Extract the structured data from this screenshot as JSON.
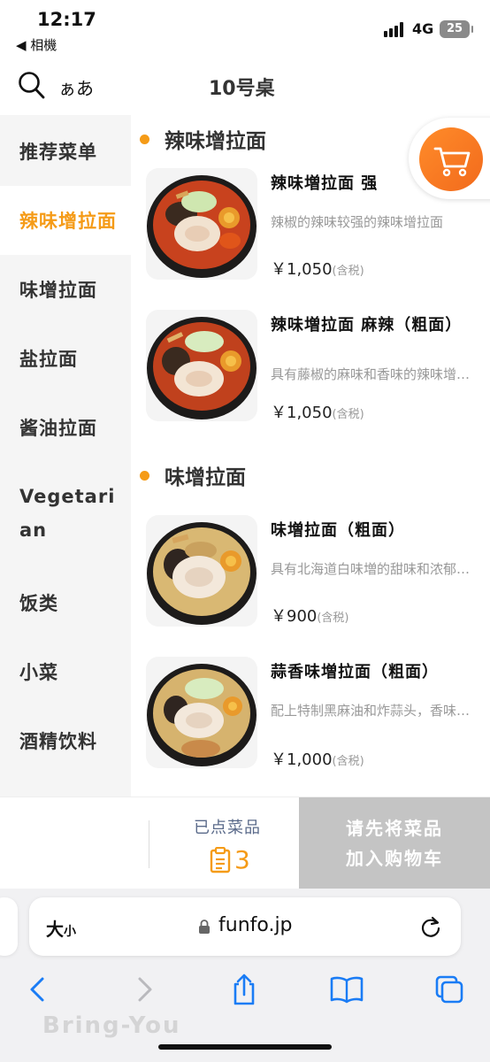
{
  "status_bar": {
    "time": "12:17",
    "back_label": "◀ 相機",
    "network": "4G",
    "battery": "25"
  },
  "header": {
    "font_toggle": "ぁあ",
    "table_title": "10号桌"
  },
  "sidebar": {
    "items": [
      {
        "label": "推荐菜单",
        "active": false
      },
      {
        "label": "辣味增拉面",
        "active": true
      },
      {
        "label": "味增拉面",
        "active": false
      },
      {
        "label": "盐拉面",
        "active": false
      },
      {
        "label": "酱油拉面",
        "active": false
      },
      {
        "label": "Vegetarian",
        "active": false
      },
      {
        "label": "饭类",
        "active": false
      },
      {
        "label": "小菜",
        "active": false
      },
      {
        "label": "酒精饮料",
        "active": false
      }
    ]
  },
  "categories": [
    {
      "title": "辣味增拉面",
      "items": [
        {
          "name": "辣味増拉面 强",
          "desc": "辣椒的辣味较强的辣味增拉面",
          "price": "￥1,050",
          "tax": "(含税)",
          "style": "spicy"
        },
        {
          "name": "辣味増拉面 麻辣（粗面）",
          "desc": "具有藤椒的麻味和香味的辣味增拉面",
          "price": "￥1,050",
          "tax": "(含税)",
          "style": "spicy"
        }
      ]
    },
    {
      "title": "味增拉面",
      "items": [
        {
          "name": "味増拉面（粗面）",
          "desc": "具有北海道白味増的甜味和浓郁口感",
          "price": "￥900",
          "tax": "(含税)",
          "style": "miso"
        },
        {
          "name": "蒜香味増拉面（粗面）",
          "desc": "配上特制黑麻油和炸蒜头，香味浓郁",
          "price": "￥1,000",
          "tax": "(含税)",
          "style": "miso"
        }
      ]
    }
  ],
  "order_bar": {
    "ordered_label": "已点菜品",
    "ordered_count": "3",
    "checkout_line1": "请先将菜品",
    "checkout_line2": "加入购物车"
  },
  "browser": {
    "aa_big": "大",
    "aa_small": "小",
    "url": "funfo.jp"
  },
  "watermark": "Bring-You",
  "colors": {
    "accent": "#f59b17",
    "cart_gradient_start": "#ff8c2a",
    "disabled_button": "#c4c4c4",
    "ios_blue": "#1a7cf5"
  }
}
